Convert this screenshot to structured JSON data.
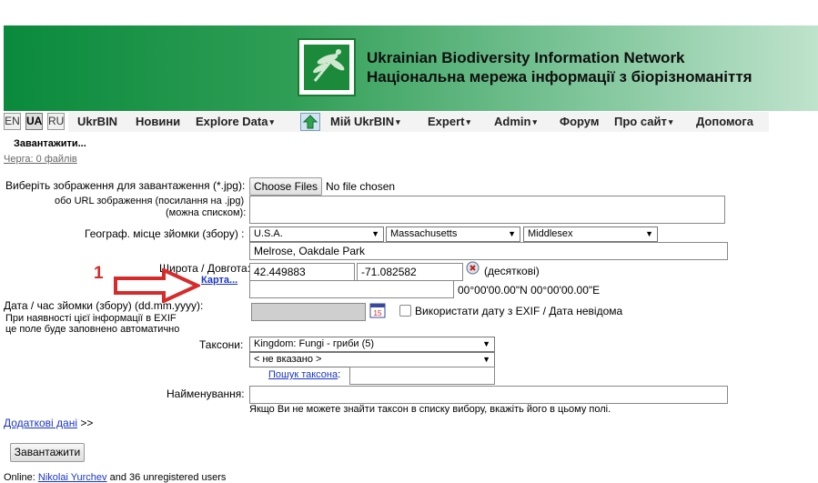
{
  "header": {
    "title_en": "Ukrainian Biodiversity Information Network",
    "title_ua": "Національна мережа інформації з біорізноманіття"
  },
  "nav": {
    "langs": [
      "EN",
      "UA",
      "RU"
    ],
    "items": [
      "UkrBIN",
      "Новини",
      "Explore Data",
      "Мій UkrBIN",
      "Expert",
      "Admin",
      "Форум",
      "Про сайт",
      "Допомога"
    ],
    "caret": "▾"
  },
  "upload_status": {
    "title": "Завантажити...",
    "queue": "Черга: 0 файлів"
  },
  "form": {
    "file_label": "Виберіть зображення для завантаження (*.jpg):",
    "file_button": "Choose Files",
    "file_status": "No file chosen",
    "url_label_1": "обо URL зображення (посилання на .jpg)",
    "url_label_2": "(можна списком):",
    "geo_label": "Географ. місце зйомки (збору) :",
    "country": "U.S.A.",
    "state": "Massachusetts",
    "county": "Middlesex",
    "locality": "Melrose, Oakdale Park",
    "latlon_label": "Широта / Довгота:",
    "map_link": "Карта...",
    "lat": "42.449883",
    "lon": "-71.082582",
    "decimal_note": "(десяткові)",
    "dms_value": "00°00'00.00\"N 00°00'00.00\"E",
    "date_label": "Дата / час зйомки (збору) (dd.mm.yyyy):",
    "exif_note_1": "При наявності цієї інформації в EXIF",
    "exif_note_2": "це поле буде заповнено автоматично",
    "exif_checkbox_label": "Використати дату з EXIF / Дата невідома",
    "taxa_label": "Таксони:",
    "kingdom": "Kingdom: Fungi - гриби (5)",
    "subtaxon": "< не вказано >",
    "taxon_search_link": "Пошук таксона",
    "taxon_search_colon": ":",
    "name_label": "Найменування:",
    "name_hint": "Якщо Ви не можете знайти таксон в списку вибору, вкажіть його в цьому полі.",
    "extra_link": "Додаткові дані",
    "extra_suffix": ">>",
    "submit": "Завантажити"
  },
  "annotation": {
    "number": "1",
    "color": "#d62b2b"
  },
  "footer": {
    "prefix": "Online:",
    "user": "Nikolai Yurchev",
    "suffix": "and 36 unregistered users"
  }
}
